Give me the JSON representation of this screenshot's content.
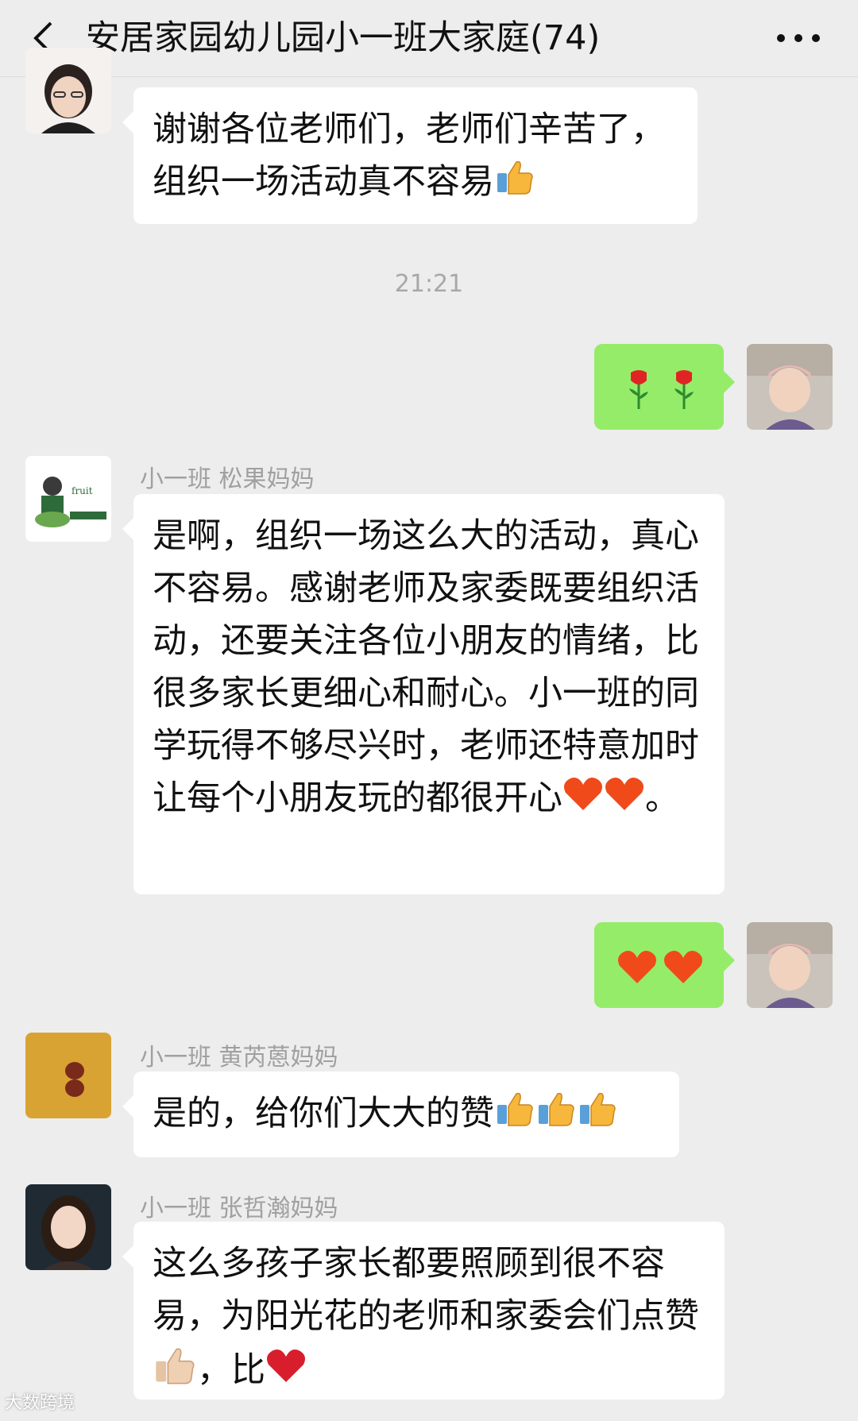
{
  "header": {
    "title": "安居家园幼儿园小一班大家庭(74)",
    "back_icon": "chevron-left-icon",
    "more_icon": "more-dots-icon"
  },
  "messages": [
    {
      "side": "left",
      "sender": "",
      "text": "谢谢各位老师们，老师们辛苦了，组织一场活动真不容易",
      "emoji": [
        "thumbs-up"
      ]
    },
    {
      "type": "time",
      "text": "21:21"
    },
    {
      "side": "right",
      "text": "",
      "emoji": [
        "rose",
        "rose"
      ]
    },
    {
      "side": "left",
      "sender": "小一班  松果妈妈",
      "text": "是啊，组织一场这么大的活动，真心不容易。感谢老师及家委既要组织活动，还要关注各位小朋友的情绪，比很多家长更细心和耐心。小一班的同学玩得不够尽兴时，老师还特意加时让每个小朋友玩的都很开心",
      "emoji": [
        "heart",
        "heart"
      ],
      "suffix": "。"
    },
    {
      "side": "right",
      "text": "",
      "emoji": [
        "heart",
        "heart"
      ]
    },
    {
      "side": "left",
      "sender": "小一班 黄芮蒽妈妈",
      "text": "是的，给你们大大的赞",
      "emoji": [
        "thumbs-up",
        "thumbs-up",
        "thumbs-up"
      ]
    },
    {
      "side": "left",
      "sender": "小一班 张哲瀚妈妈",
      "text": "这么多孩子家长都要照顾到很不容易，为阳光花的老师和家委会们点赞",
      "emoji": [
        "thumbs-up"
      ],
      "suffix": "，比",
      "suffix_emoji": [
        "heart-red"
      ]
    }
  ],
  "watermark": "大数跨境",
  "colors": {
    "background": "#ededed",
    "my_bubble": "#95ec69",
    "other_bubble": "#ffffff",
    "sender_name": "#a0a0a0"
  }
}
